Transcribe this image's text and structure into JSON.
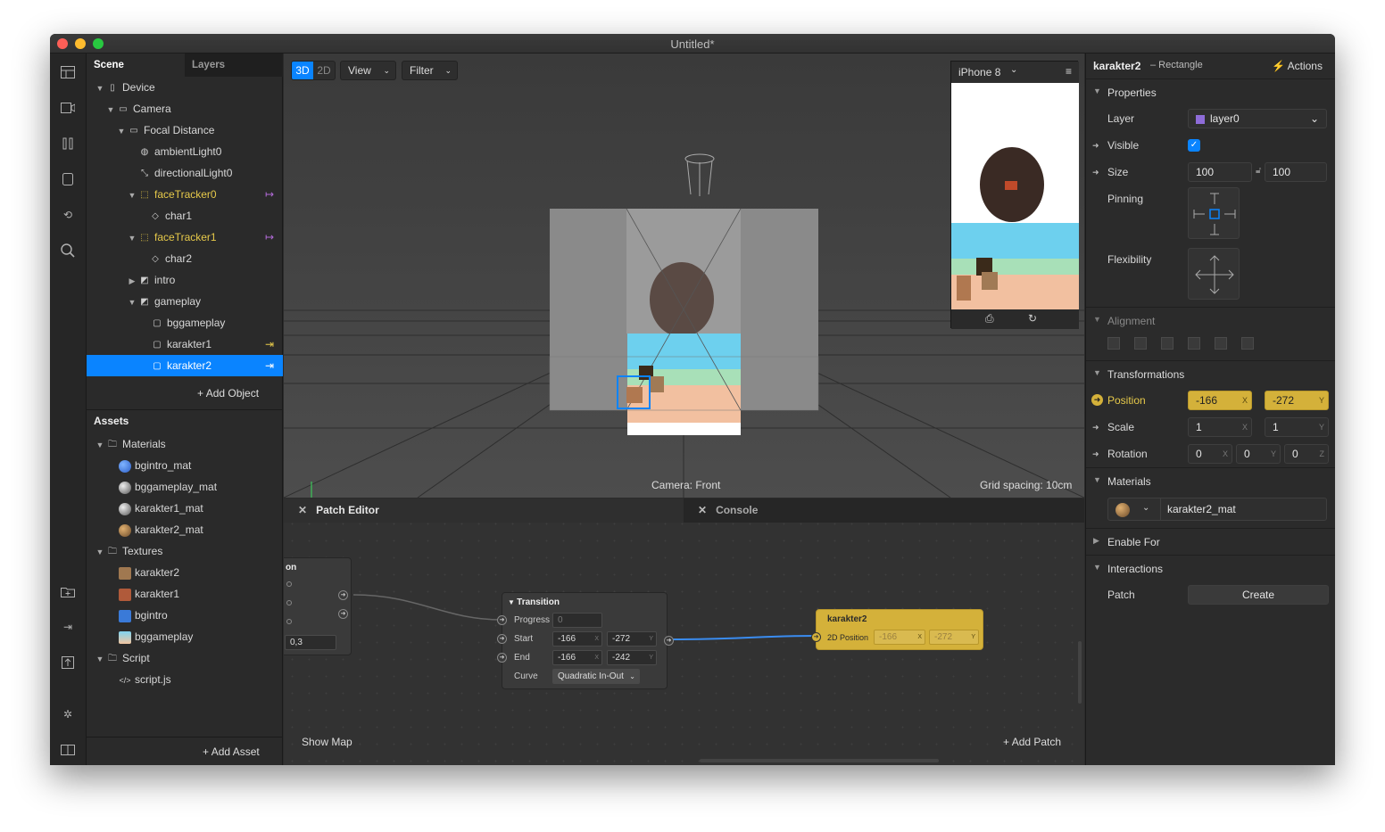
{
  "window": {
    "title": "Untitled*"
  },
  "scene_tabs": {
    "scene": "Scene",
    "layers": "Layers"
  },
  "scene_tree": [
    {
      "label": "Device"
    },
    {
      "label": "Camera"
    },
    {
      "label": "Focal Distance"
    },
    {
      "label": "ambientLight0"
    },
    {
      "label": "directionalLight0"
    },
    {
      "label": "faceTracker0"
    },
    {
      "label": "char1"
    },
    {
      "label": "faceTracker1"
    },
    {
      "label": "char2"
    },
    {
      "label": "intro"
    },
    {
      "label": "gameplay"
    },
    {
      "label": "bggameplay"
    },
    {
      "label": "karakter1"
    },
    {
      "label": "karakter2"
    }
  ],
  "add_object": "Add Object",
  "assets": {
    "title": "Assets",
    "items": [
      {
        "label": "Materials"
      },
      {
        "label": "bgintro_mat"
      },
      {
        "label": "bggameplay_mat"
      },
      {
        "label": "karakter1_mat"
      },
      {
        "label": "karakter2_mat"
      },
      {
        "label": "Textures"
      },
      {
        "label": "karakter2"
      },
      {
        "label": "karakter1"
      },
      {
        "label": "bgintro"
      },
      {
        "label": "bggameplay"
      },
      {
        "label": "Script"
      },
      {
        "label": "script.js"
      }
    ],
    "add_asset": "Add Asset"
  },
  "viewport": {
    "mode_3d": "3D",
    "mode_2d": "2D",
    "view": "View",
    "filter": "Filter",
    "device": "iPhone 8",
    "camera_label": "Camera: Front",
    "grid_label": "Grid spacing: 10cm"
  },
  "patch_editor": {
    "tab_patch": "Patch Editor",
    "tab_console": "Console",
    "left_node": {
      "title_fragment": "on",
      "value": "0,3"
    },
    "transition": {
      "title": "Transition",
      "progress_label": "Progress",
      "progress": "0",
      "start_label": "Start",
      "start_x": "-166",
      "start_y": "-272",
      "end_label": "End",
      "end_x": "-166",
      "end_y": "-242",
      "curve_label": "Curve",
      "curve": "Quadratic In-Out"
    },
    "karakter2_node": {
      "title": "karakter2",
      "port": "2D Position",
      "x": "-166",
      "y": "-272"
    },
    "show_map": "Show Map",
    "add_patch": "Add Patch"
  },
  "inspector": {
    "object_name": "karakter2",
    "object_type": "– Rectangle",
    "actions": "Actions",
    "properties": "Properties",
    "layer_label": "Layer",
    "layer_value": "layer0",
    "visible_label": "Visible",
    "size_label": "Size",
    "size_w": "100",
    "size_h": "100",
    "pinning_label": "Pinning",
    "flexibility_label": "Flexibility",
    "alignment": "Alignment",
    "transformations": "Transformations",
    "position_label": "Position",
    "pos_x": "-166",
    "pos_y": "-272",
    "scale_label": "Scale",
    "scale_x": "1",
    "scale_y": "1",
    "rotation_label": "Rotation",
    "rot_x": "0",
    "rot_y": "0",
    "rot_z": "0",
    "materials": "Materials",
    "material_value": "karakter2_mat",
    "enable_for": "Enable For",
    "interactions": "Interactions",
    "patch_label": "Patch",
    "create": "Create",
    "axis_x": "X",
    "axis_y": "Y",
    "axis_z": "Z"
  },
  "colors": {
    "accent": "#0a84ff",
    "tracker": "#e6c94a",
    "patch_yellow": "#d4b13a",
    "layer_swatch": "#8e6cd8"
  }
}
